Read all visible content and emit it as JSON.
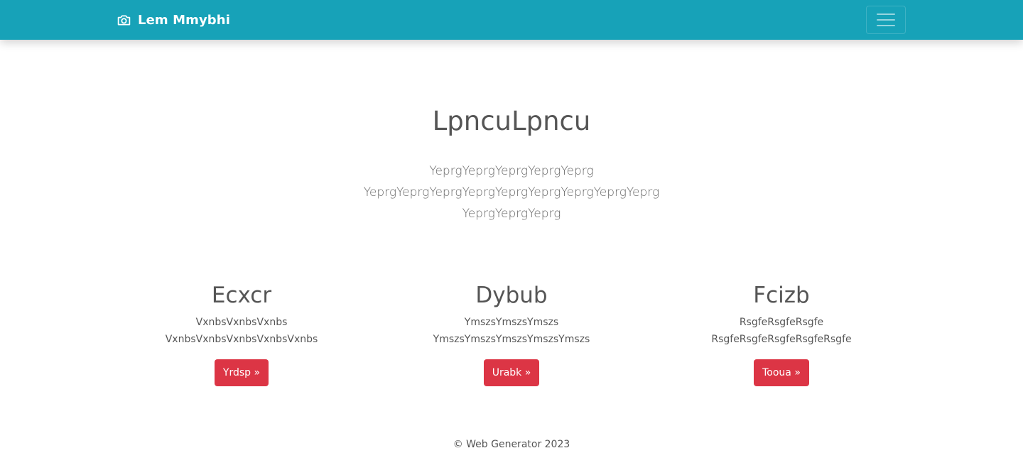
{
  "navbar": {
    "brand_icon": "camera-icon",
    "brand_text": "Lem Mmybhi",
    "toggler_icon": "hamburger-menu-icon",
    "background_color": "#17a2b8"
  },
  "hero": {
    "title": "LpncuLpncu",
    "lines": [
      "YeprgYeprgYeprgYeprgYeprg",
      "YeprgYeprgYeprgYeprgYeprgYeprgYeprgYeprgYeprg",
      "YeprgYeprgYeprg"
    ]
  },
  "features": [
    {
      "title": "Ecxcr",
      "lines": [
        "VxnbsVxnbsVxnbs",
        "VxnbsVxnbsVxnbsVxnbsVxnbs"
      ],
      "button": "Yrdsp »"
    },
    {
      "title": "Dybub",
      "lines": [
        "YmszsYmszsYmszs",
        "YmszsYmszsYmszsYmszsYmszs"
      ],
      "button": "Urabk »"
    },
    {
      "title": "Fcizb",
      "lines": [
        "RsgfeRsgfeRsgfe",
        "RsgfeRsgfeRsgfeRsgfeRsgfe"
      ],
      "button": "Tooua »"
    }
  ],
  "button_color": "#dc3545",
  "footer": {
    "text": "© Web Generator 2023"
  }
}
